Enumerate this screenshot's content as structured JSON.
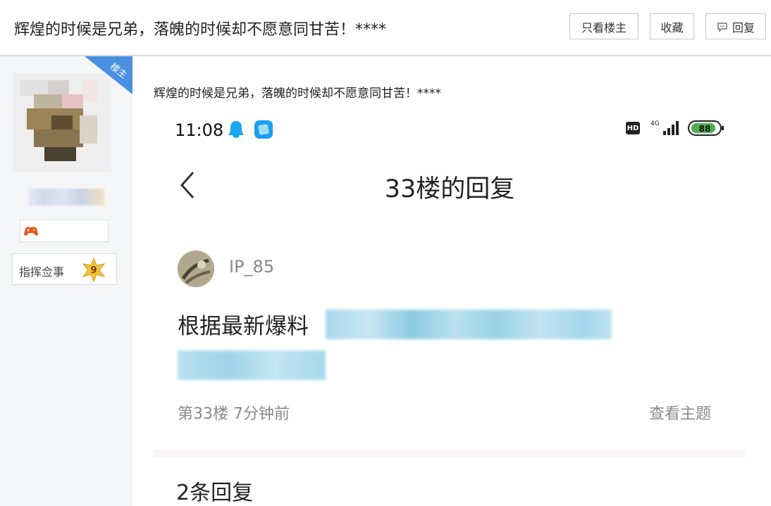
{
  "header": {
    "title": "辉煌的时候是兄弟，落魄的时候却不愿意同甘苦！****",
    "buttons": {
      "only_op": "只看楼主",
      "favorite": "收藏",
      "reply": "回复"
    }
  },
  "sidebar": {
    "op_tag": "楼主",
    "rank": {
      "title": "指挥佥事",
      "level": "9"
    }
  },
  "post": {
    "text": "辉煌的时候是兄弟，落魄的时候却不愿意同甘苦！****"
  },
  "screenshot": {
    "status_bar": {
      "time": "11:08",
      "hd": "HD",
      "network": "4G",
      "battery": "88"
    },
    "page_title": "33楼的回复",
    "comment": {
      "username": "IP_85",
      "text_prefix": "根据最新爆料",
      "floor": "第33楼  7分钟前",
      "view_topic": "查看主题"
    },
    "replies_count": "2条回复"
  },
  "colors": {
    "op_tag": "#4a90e2",
    "level_badge": "#f2c23b",
    "battery": "#4caf50"
  }
}
